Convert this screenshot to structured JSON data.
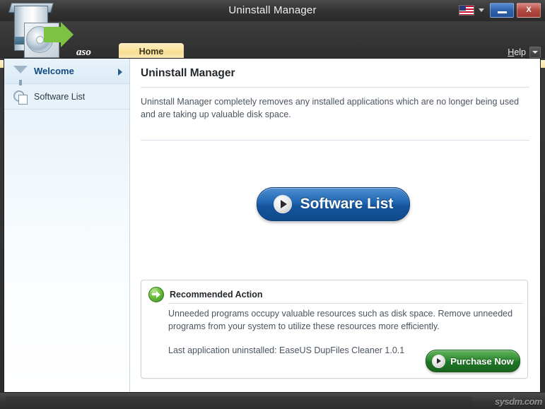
{
  "window": {
    "title": "Uninstall Manager",
    "minimize_label": "",
    "close_label": "X",
    "language_icon": "us-flag-icon"
  },
  "tabstrip": {
    "brand": "aso",
    "tabs": [
      {
        "label": "Home",
        "active": true
      }
    ],
    "help_prefix": "H",
    "help_rest": "elp"
  },
  "sidebar": {
    "items": [
      {
        "label": "Welcome",
        "icon": "funnel-icon",
        "active": true
      },
      {
        "label": "Software List",
        "icon": "magnifier-doc-icon",
        "active": false
      }
    ]
  },
  "main": {
    "page_title": "Uninstall Manager",
    "description": "Uninstall Manager completely removes any installed applications which are no longer being used and are taking up valuable disk space.",
    "cta": {
      "label": "Software List",
      "icon": "play-circle-icon",
      "color": "#15559d"
    },
    "panel": {
      "title": "Recommended Action",
      "icon": "green-arrow-circle-icon",
      "body": "Unneeded programs occupy valuable resources such as disk space. Remove unneeded programs from your system to utilize these resources more efficiently.",
      "last_uninstalled": "Last application uninstalled:  EaseUS DupFiles Cleaner 1.0.1",
      "purchase": {
        "label": "Purchase Now",
        "icon": "play-circle-icon",
        "color": "#1f7527"
      }
    }
  },
  "statusbar": {
    "watermark": "sysdm.com"
  }
}
